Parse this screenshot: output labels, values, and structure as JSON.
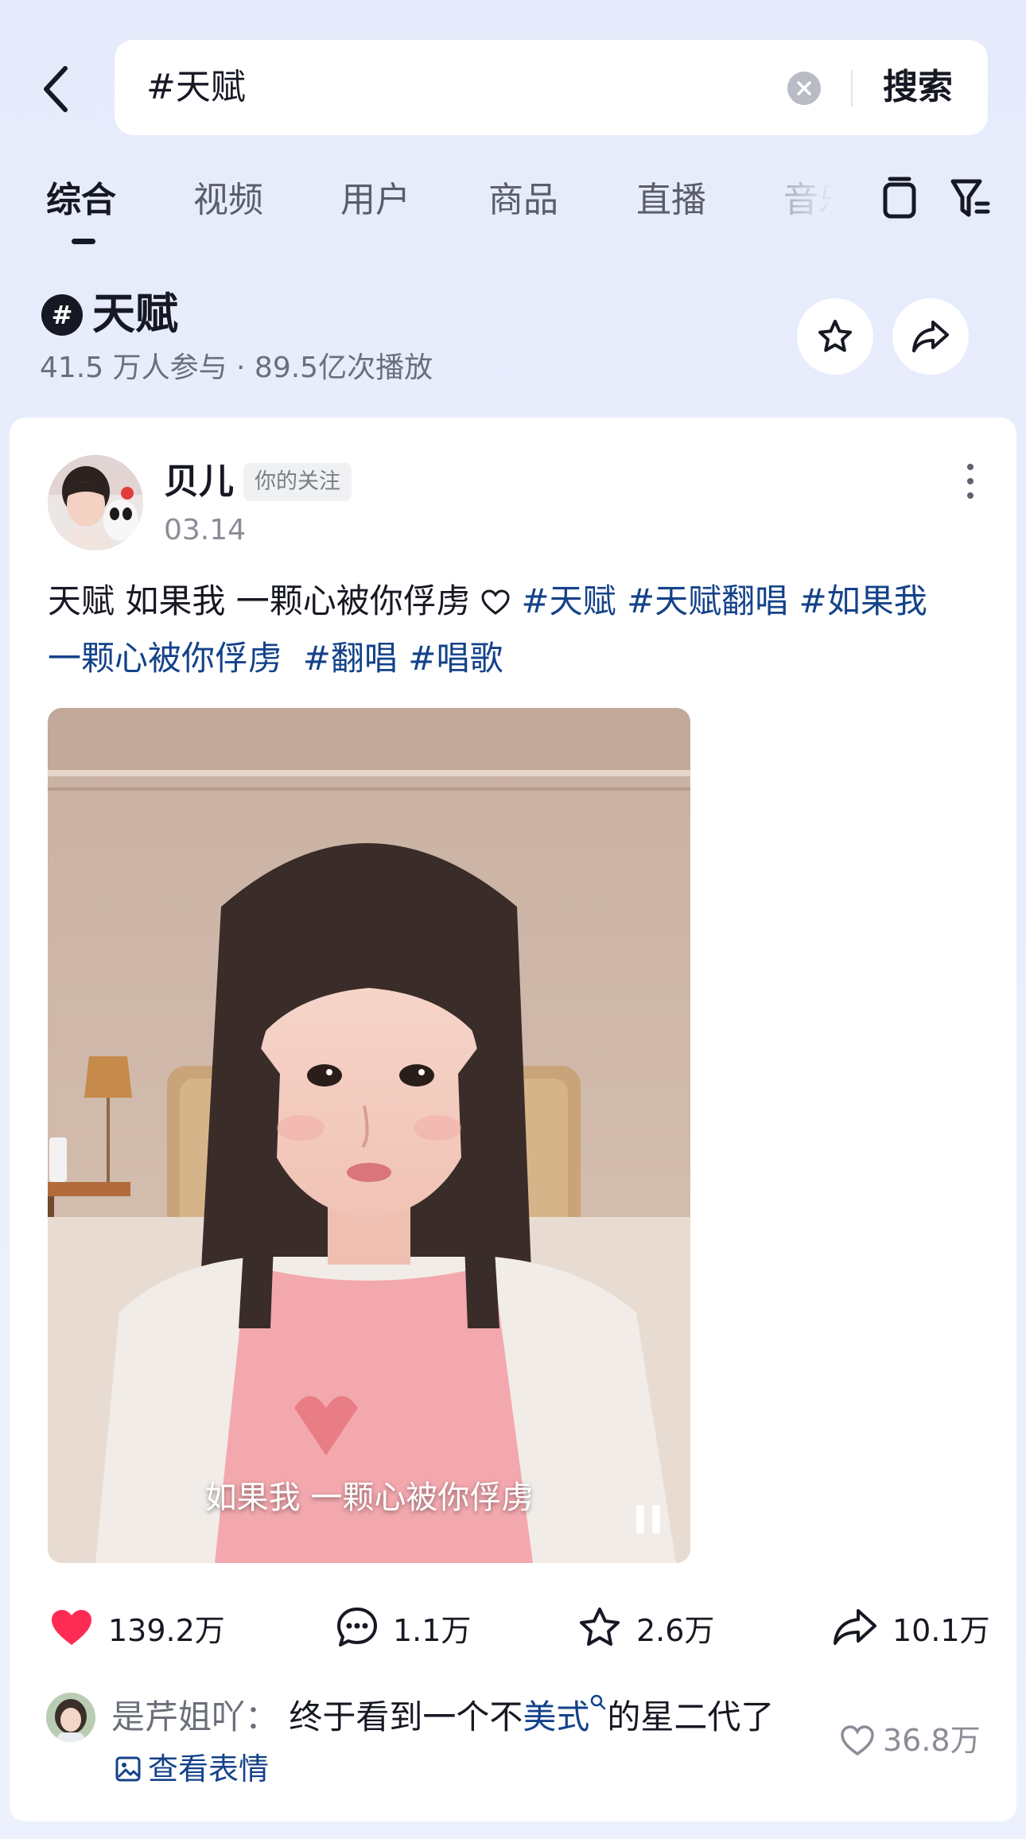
{
  "search": {
    "query": "#天赋",
    "button_label": "搜索"
  },
  "tabs": [
    {
      "label": "综合",
      "active": true
    },
    {
      "label": "视频"
    },
    {
      "label": "用户"
    },
    {
      "label": "商品"
    },
    {
      "label": "直播"
    },
    {
      "label": "音乐"
    }
  ],
  "topic": {
    "badge": "#",
    "title": "天赋",
    "stats": "41.5 万人参与 · 89.5亿次播放"
  },
  "post": {
    "author": "贝儿",
    "follow_badge": "你的关注",
    "date": "03.14",
    "caption_text": "天赋 如果我 一颗心被你俘虏",
    "tags": [
      "#天赋",
      "#天赋翻唱",
      "#如果我一颗心被你俘虏",
      "#翻唱",
      "#唱歌"
    ],
    "tag_line1": "#天赋 #天赋翻唱 #如果我",
    "tag_line2a": "一颗心被你俘虏",
    "tag_line2b": "#翻唱",
    "tag_line2c": "#唱歌",
    "video_subtitle": "如果我 一颗心被你俘虏",
    "likes": "139.2万",
    "comments": "1.1万",
    "favorites": "2.6万",
    "shares": "10.1万"
  },
  "comment": {
    "user": "是芹姐吖：",
    "text_before": "终于看到一个不",
    "link_text": "美式",
    "text_after": "的星二代了",
    "view_emoji": "查看表情",
    "likes": "36.8万"
  },
  "colors": {
    "accent_tag": "#14428a",
    "like_red": "#fe2c55",
    "background": "#e8edfc"
  }
}
